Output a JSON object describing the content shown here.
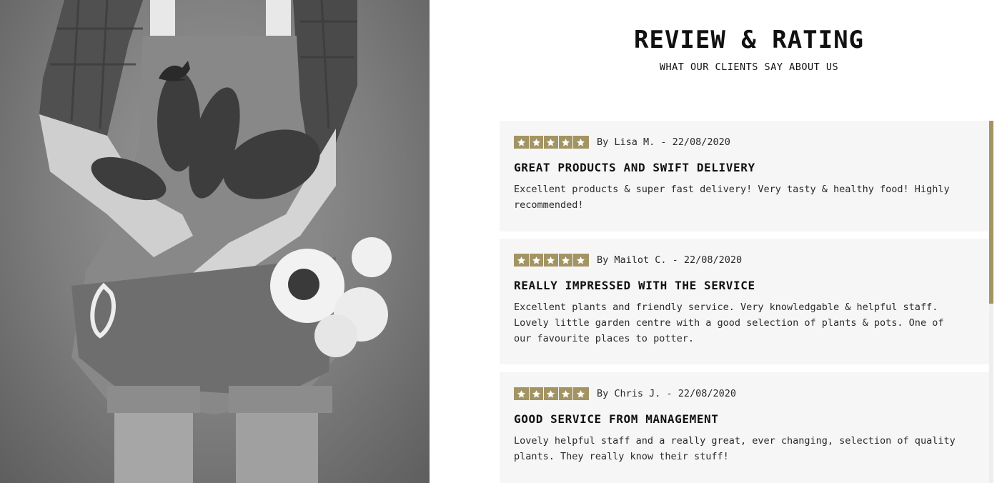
{
  "section": {
    "title": "REVIEW & RATING",
    "subtitle": "WHAT OUR CLIENTS SAY ABOUT US"
  },
  "colors": {
    "accent": "#a39464",
    "card_background": "#f6f6f6"
  },
  "photo": {
    "icon": "kangaroo-logo-icon"
  },
  "reviews": [
    {
      "stars": 5,
      "author": "By Lisa M. - 22/08/2020",
      "title": "GREAT PRODUCTS AND SWIFT DELIVERY",
      "text": "Excellent products & super fast delivery! Very tasty & healthy food! Highly recommended!"
    },
    {
      "stars": 5,
      "author": "By Mailot C. - 22/08/2020",
      "title": "REALLY IMPRESSED WITH THE SERVICE",
      "text": "Excellent plants and friendly service. Very knowledgable & helpful staff. Lovely little garden centre with a good selection of plants & pots. One of our favourite places to potter."
    },
    {
      "stars": 5,
      "author": "By Chris J. - 22/08/2020",
      "title": "GOOD SERVICE FROM MANAGEMENT",
      "text": "Lovely helpful staff and a really great, ever changing, selection of quality plants. They really know their stuff!"
    }
  ]
}
